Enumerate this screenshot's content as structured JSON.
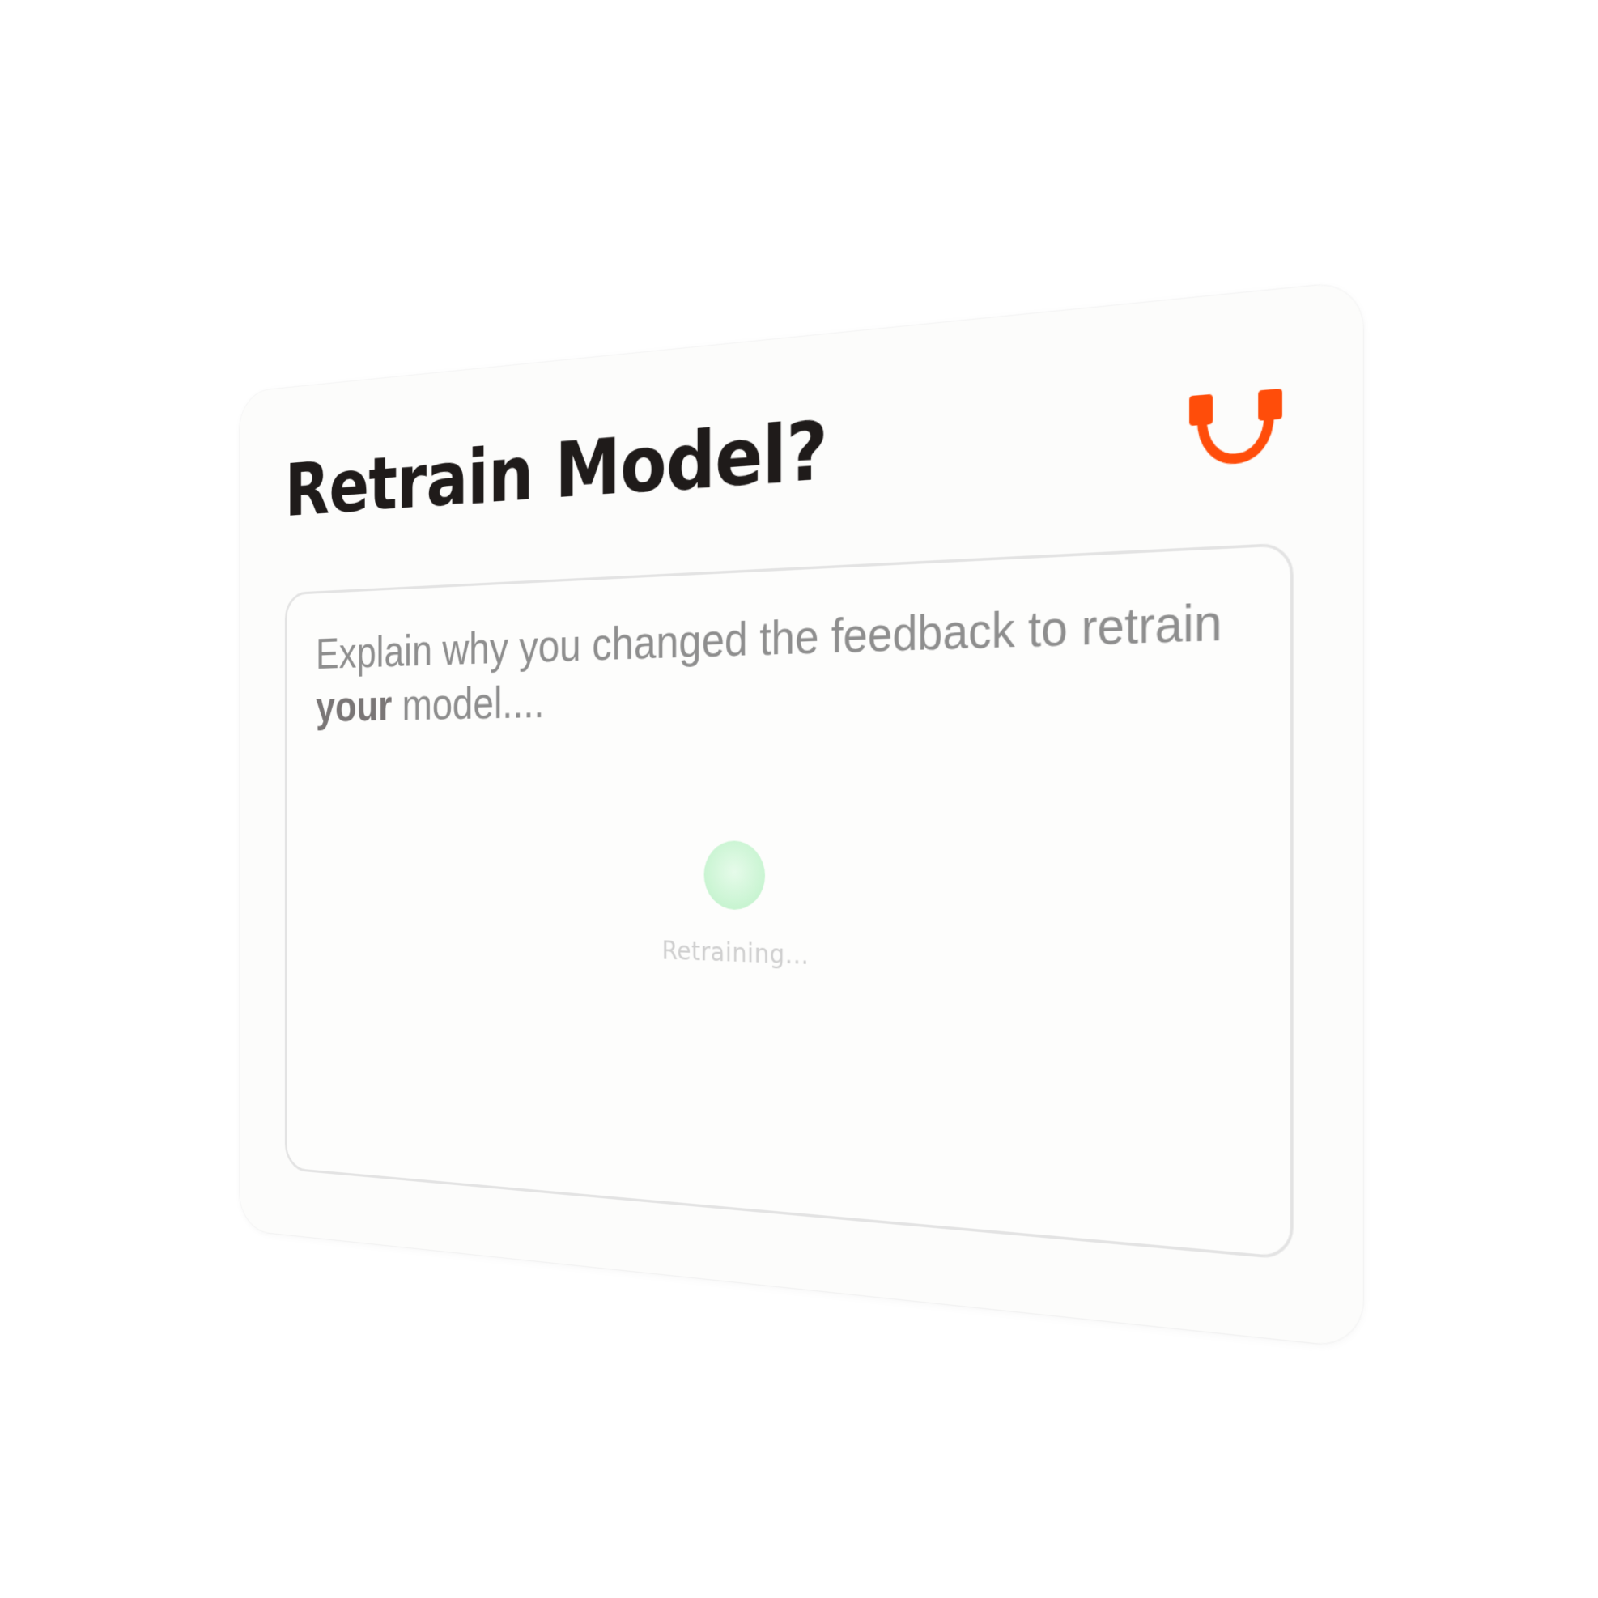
{
  "dialog": {
    "title": "Retrain Model?",
    "support_icon": "headset-icon",
    "accent_color": "#ff4d0a"
  },
  "feedback": {
    "placeholder_prefix": "Explain why you changed the feedback to retrain ",
    "placeholder_bold": "your",
    "placeholder_suffix": " model....",
    "value": ""
  },
  "status": {
    "text": "Retraining...",
    "indicator_color": "#c8f4d1"
  }
}
